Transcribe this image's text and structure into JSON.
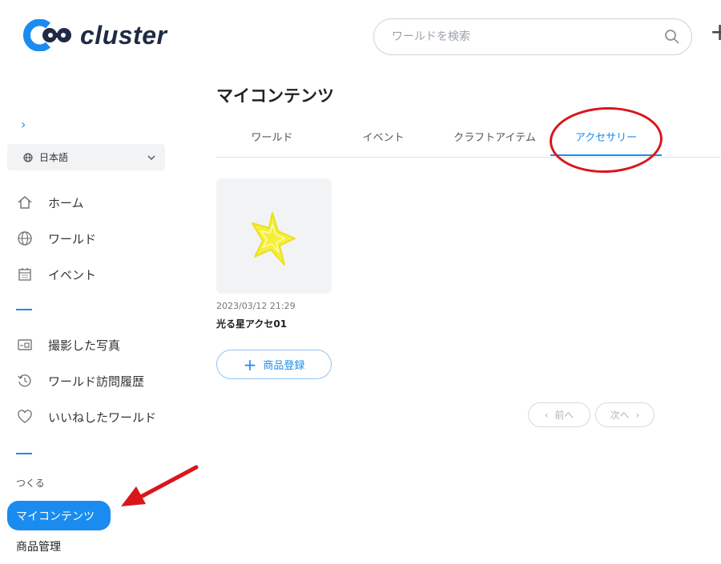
{
  "brand": {
    "name": "cluster"
  },
  "search": {
    "placeholder": "ワールドを検索"
  },
  "top_actions": {
    "plus": "+"
  },
  "sidebar": {
    "expand": "›",
    "language": "日本語",
    "nav": [
      {
        "label": "ホーム",
        "icon": "home-icon"
      },
      {
        "label": "ワールド",
        "icon": "globe-icon"
      },
      {
        "label": "イベント",
        "icon": "calendar-icon"
      }
    ],
    "nav2": [
      {
        "label": "撮影した写真",
        "icon": "photo-icon"
      },
      {
        "label": "ワールド訪問履歴",
        "icon": "history-icon"
      },
      {
        "label": "いいねしたワールド",
        "icon": "heart-icon"
      }
    ],
    "section_label": "つくる",
    "active_item": "マイコンテンツ",
    "goods": "商品管理"
  },
  "main": {
    "title": "マイコンテンツ",
    "tabs": [
      {
        "label": "ワールド",
        "active": false
      },
      {
        "label": "イベント",
        "active": false
      },
      {
        "label": "クラフトアイテム",
        "active": false
      },
      {
        "label": "アクセサリー",
        "active": true
      }
    ],
    "items": [
      {
        "date": "2023/03/12 21:29",
        "name": "光る星アクセ01",
        "thumbnail_icon": "star-icon"
      }
    ],
    "register_label": "商品登録",
    "pagination": {
      "prev": "前へ",
      "next": "次へ"
    }
  },
  "colors": {
    "accent": "#1a8cf0",
    "annotation": "#d9161c",
    "star": "#f4ef3c"
  }
}
